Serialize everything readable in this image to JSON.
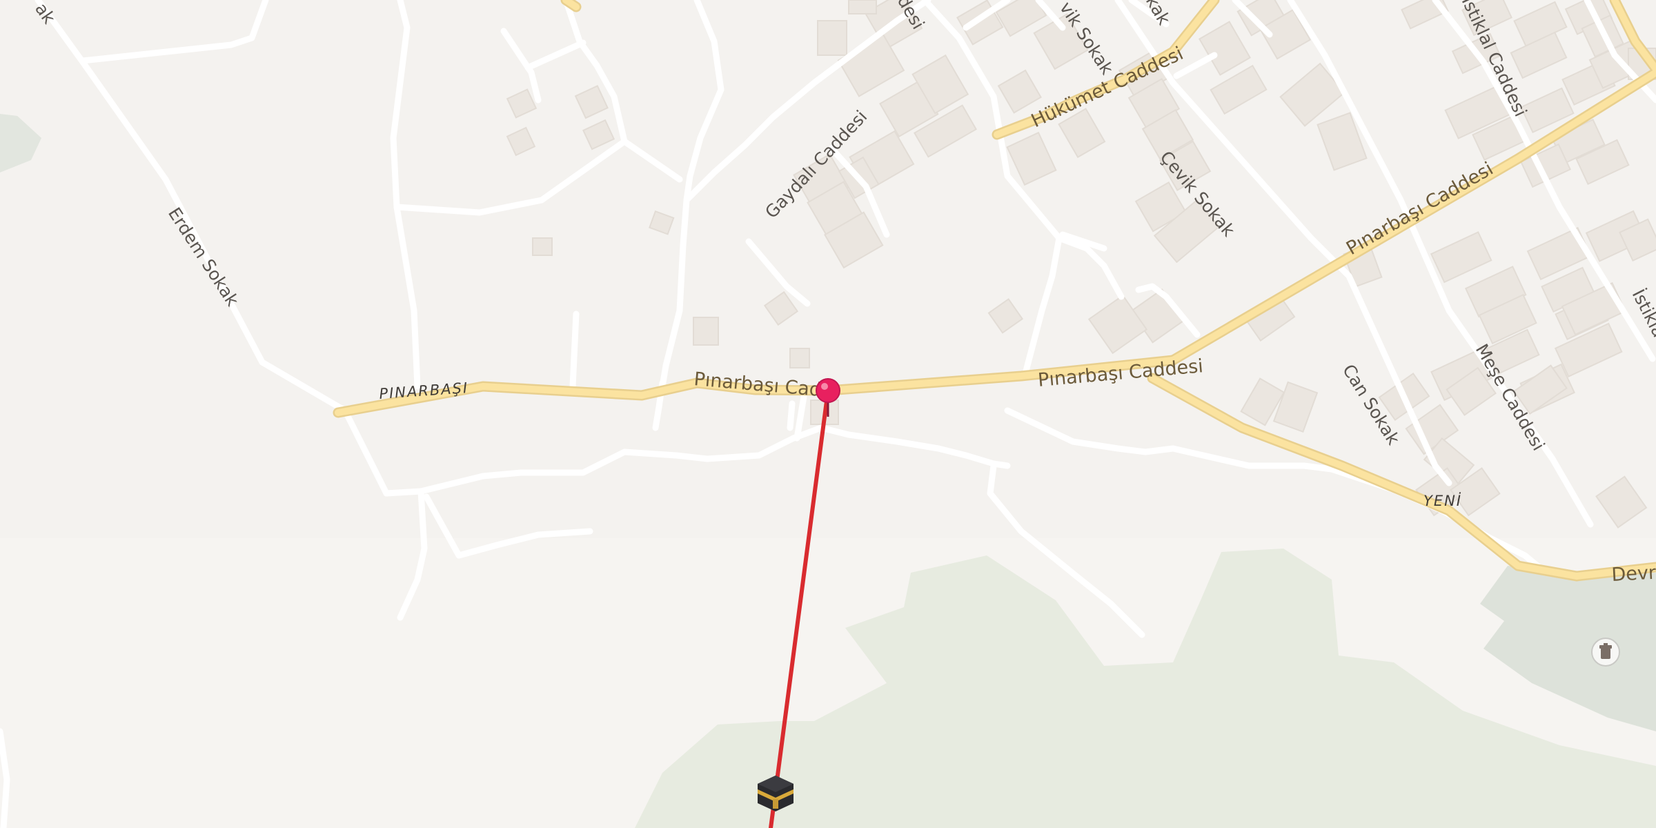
{
  "map": {
    "colors": {
      "land": "#f4f2ef",
      "road_minor": "#ffffff",
      "road_major": "#fbe3a0",
      "road_major_casing": "#e8cf8e",
      "building": "#ebe6e0",
      "park": "#e7ebe0",
      "cemetery": "#dde2da",
      "route_line": "#d92b2f",
      "pin": "#e8205f"
    },
    "street_labels": {
      "erdem": "Erdem Sokak",
      "pinarbasi_area": "PINARBAŞI",
      "pinarbasi_1": "Pınarbaşı Cadd",
      "pinarbasi_2": "Pınarbaşı Caddesi",
      "pinarbasi_3": "Pınarbaşı Caddesi",
      "gaydali": "Gaydalı Caddesi",
      "hukumet": "Hükümet Caddesi",
      "cevik_1": "Çevik Sokak",
      "cevik_2": "vik Sokak",
      "can": "Can Sokak",
      "mese": "Meşe Caddesi",
      "istiklal_1": "İstiklal Caddesi",
      "istiklal_2": "İstikla",
      "yeni": "YENİ",
      "devrim": "Devrim",
      "top_left": "ak",
      "top_mid": "desi",
      "top_right": "kak"
    },
    "markers": {
      "location_pin": "location-pin-icon",
      "kaaba": "kaaba-icon",
      "cemetery": "cemetery-icon"
    }
  }
}
